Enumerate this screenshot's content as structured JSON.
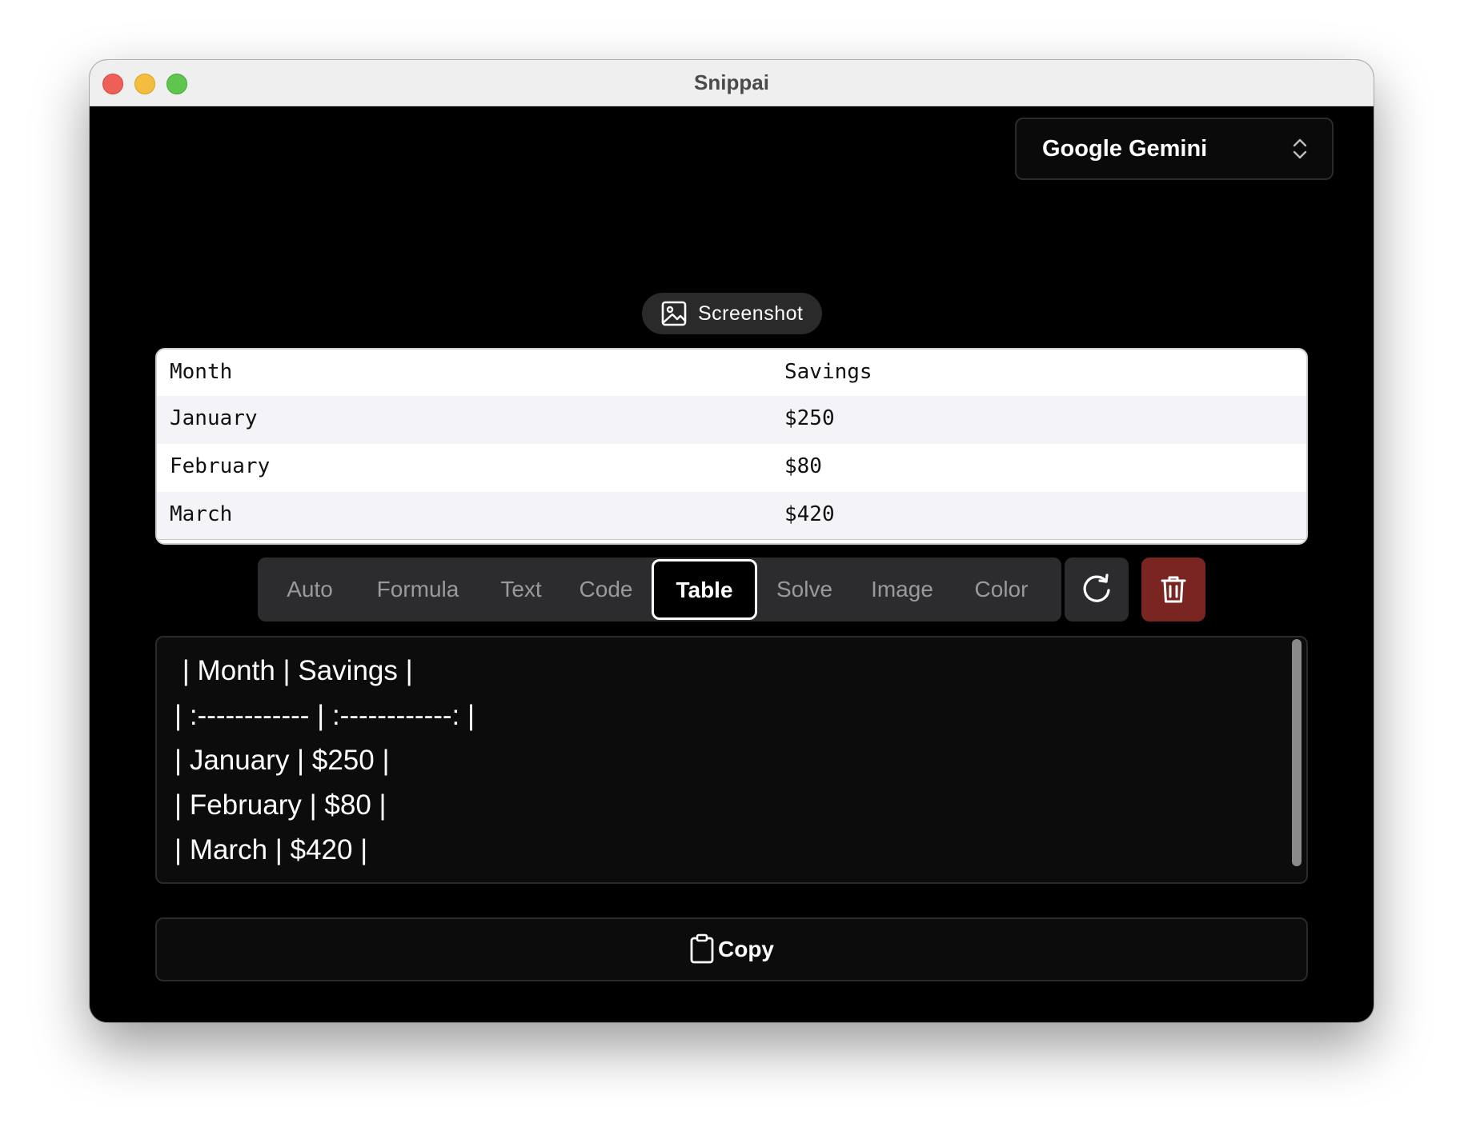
{
  "window": {
    "title": "Snippai"
  },
  "model_select": {
    "value": "Google Gemini",
    "icon": "chevron-up-down-icon"
  },
  "screenshot_button": {
    "label": "Screenshot",
    "icon": "image-icon"
  },
  "preview_table": {
    "rows": [
      [
        "Month",
        "Savings"
      ],
      [
        "January",
        "$250"
      ],
      [
        "February",
        "$80"
      ],
      [
        "March",
        "$420"
      ]
    ]
  },
  "modes": {
    "items": [
      "Auto",
      "Formula",
      "Text",
      "Code",
      "Table",
      "Solve",
      "Image",
      "Color"
    ],
    "selected": "Table"
  },
  "actions": {
    "refresh_icon": "refresh-icon",
    "delete_icon": "trash-icon",
    "delete_color": "#7b2523"
  },
  "output": {
    "lines": [
      " | Month | Savings |",
      "| :------------ | :------------: |",
      "| January | $250 |",
      "| February | $80 |",
      "| March | $420 |"
    ]
  },
  "copy_button": {
    "label": "Copy",
    "icon": "clipboard-icon"
  }
}
